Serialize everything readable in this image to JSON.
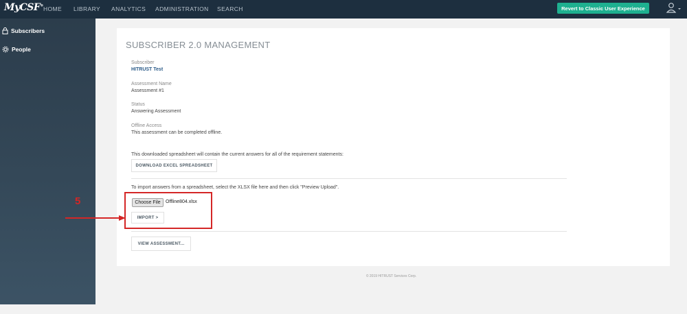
{
  "header": {
    "logo": "MyCSF",
    "logo_mark": "®",
    "nav": [
      "HOME",
      "LIBRARY",
      "ANALYTICS",
      "ADMINISTRATION",
      "SEARCH"
    ],
    "revert_button": "Revert to Classic User Experience",
    "user_icon": "user-icon",
    "accent_color": "#1eb090",
    "bar_color": "#1d2f3f"
  },
  "sidebar": {
    "items": [
      {
        "label": "Subscribers",
        "icon": "lock-icon"
      },
      {
        "label": "People",
        "icon": "gear-icon"
      }
    ]
  },
  "main": {
    "title": "SUBSCRIBER 2.0 MANAGEMENT",
    "fields": [
      {
        "label": "Subscriber",
        "value": "HITRUST Test"
      },
      {
        "label": "Assessment Name",
        "value": "Assessment #1"
      },
      {
        "label": "Status",
        "value": "Answering Assessment"
      },
      {
        "label": "Offline Access",
        "value": "This assessment can be completed offline."
      }
    ],
    "download_hint": "This downloaded spreadsheet will contain the current answers for all of the requirement statements:",
    "download_button": "DOWNLOAD EXCEL SPREADSHEET",
    "import_hint": "To import answers from a spreadsheet, select the XLSX file here and then click \"Preview Upload\".",
    "choose_file_button": "Choose File",
    "file_name": "Offline804.xlsx",
    "import_button": "IMPORT >",
    "view_button": "VIEW ASSESSMENT..."
  },
  "annotation": {
    "step_number": "5",
    "color": "#d42626"
  },
  "footer": {
    "text": "© 2019 HITRUST Services Corp."
  }
}
